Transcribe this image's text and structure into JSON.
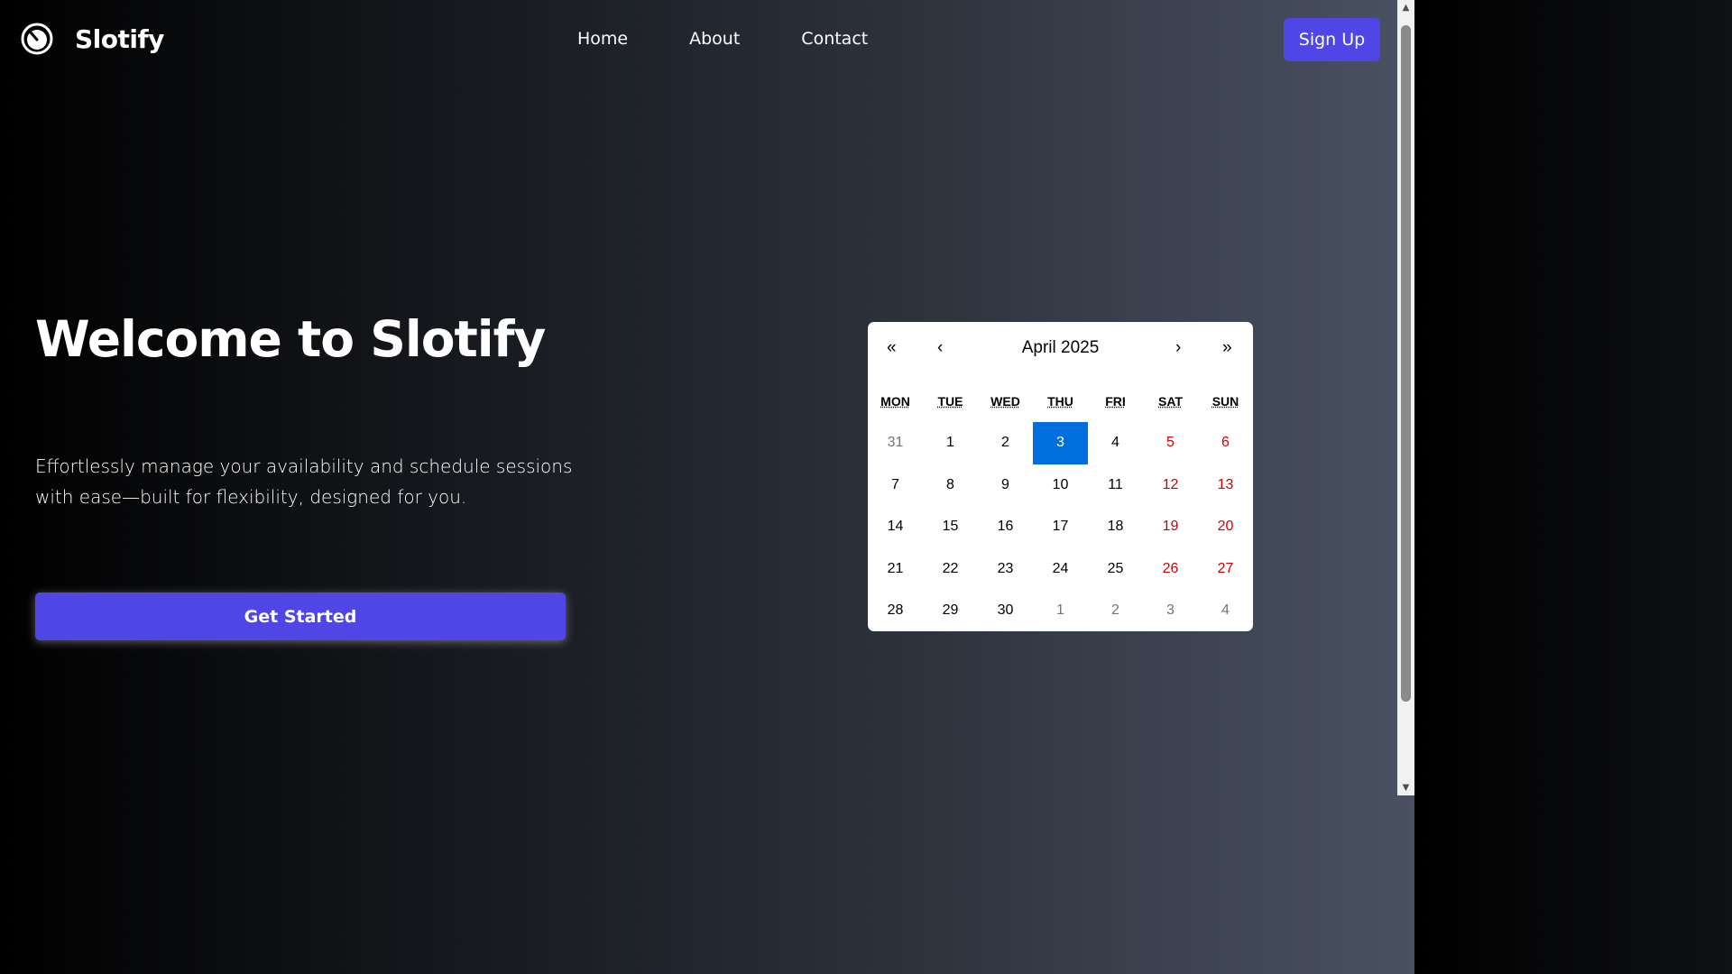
{
  "brand": {
    "name": "Slotify",
    "logo_icon": "timer-icon"
  },
  "nav": {
    "links": [
      {
        "label": "Home"
      },
      {
        "label": "About"
      },
      {
        "label": "Contact"
      }
    ],
    "signup_label": "Sign Up"
  },
  "hero": {
    "title": "Welcome to Slotify",
    "subtitle": "Effortlessly manage your availability and schedule sessions with ease—built for flexibility, designed for you.",
    "cta_label": "Get Started"
  },
  "calendar": {
    "month_label": "April 2025",
    "prev_year": "«",
    "prev_month": "‹",
    "next_month": "›",
    "next_year": "»",
    "weekdays": [
      "MON",
      "TUE",
      "WED",
      "THU",
      "FRI",
      "SAT",
      "SUN"
    ],
    "days": [
      {
        "label": "31",
        "kind": "other"
      },
      {
        "label": "1",
        "kind": "normal"
      },
      {
        "label": "2",
        "kind": "normal"
      },
      {
        "label": "3",
        "kind": "active"
      },
      {
        "label": "4",
        "kind": "normal"
      },
      {
        "label": "5",
        "kind": "weekend"
      },
      {
        "label": "6",
        "kind": "weekend"
      },
      {
        "label": "7",
        "kind": "normal"
      },
      {
        "label": "8",
        "kind": "normal"
      },
      {
        "label": "9",
        "kind": "normal"
      },
      {
        "label": "10",
        "kind": "normal"
      },
      {
        "label": "11",
        "kind": "normal"
      },
      {
        "label": "12",
        "kind": "weekend"
      },
      {
        "label": "13",
        "kind": "weekend"
      },
      {
        "label": "14",
        "kind": "normal"
      },
      {
        "label": "15",
        "kind": "normal"
      },
      {
        "label": "16",
        "kind": "normal"
      },
      {
        "label": "17",
        "kind": "normal"
      },
      {
        "label": "18",
        "kind": "normal"
      },
      {
        "label": "19",
        "kind": "weekend"
      },
      {
        "label": "20",
        "kind": "weekend"
      },
      {
        "label": "21",
        "kind": "normal"
      },
      {
        "label": "22",
        "kind": "normal"
      },
      {
        "label": "23",
        "kind": "normal"
      },
      {
        "label": "24",
        "kind": "normal"
      },
      {
        "label": "25",
        "kind": "normal"
      },
      {
        "label": "26",
        "kind": "weekend"
      },
      {
        "label": "27",
        "kind": "weekend"
      },
      {
        "label": "28",
        "kind": "normal"
      },
      {
        "label": "29",
        "kind": "normal"
      },
      {
        "label": "30",
        "kind": "normal"
      },
      {
        "label": "1",
        "kind": "other"
      },
      {
        "label": "2",
        "kind": "other"
      },
      {
        "label": "3",
        "kind": "other"
      },
      {
        "label": "4",
        "kind": "other"
      }
    ]
  },
  "colors": {
    "accent": "#4f46e5",
    "selected_day": "#006edc",
    "weekend_day": "#d10000",
    "other_month_day": "#757575"
  }
}
